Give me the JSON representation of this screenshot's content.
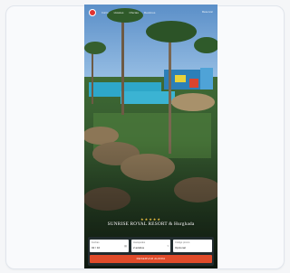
{
  "header": {
    "nav": [
      "Inicio",
      "Hoteles",
      "Ofertas",
      "Destinos"
    ],
    "menu_label": "Reservar"
  },
  "hero": {
    "stars": "★★★★★",
    "title": "SUNRISE ROYAL RESORT & Hurghada"
  },
  "booking": {
    "fields": [
      {
        "label": "Fechas",
        "value": "02 / 10"
      },
      {
        "label": "Huéspedes",
        "value": "2 adultos"
      },
      {
        "label": "Código promo",
        "value": "Opcional"
      }
    ],
    "search_label": "RESERVAR AHORA"
  },
  "colors": {
    "brand_red": "#e2332f",
    "cta_orange": "#e04b2a",
    "stars": "#f3c544"
  }
}
